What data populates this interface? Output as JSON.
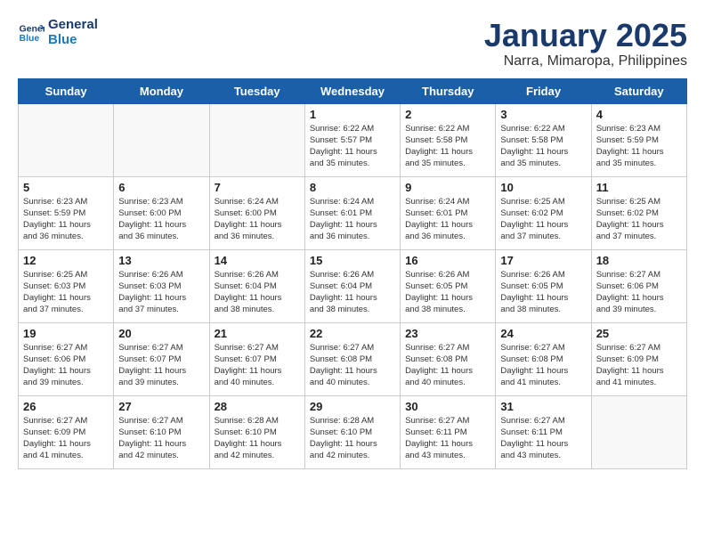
{
  "logo": {
    "line1": "General",
    "line2": "Blue"
  },
  "title": "January 2025",
  "subtitle": "Narra, Mimaropa, Philippines",
  "days": [
    "Sunday",
    "Monday",
    "Tuesday",
    "Wednesday",
    "Thursday",
    "Friday",
    "Saturday"
  ],
  "weeks": [
    [
      {
        "day": "",
        "info": ""
      },
      {
        "day": "",
        "info": ""
      },
      {
        "day": "",
        "info": ""
      },
      {
        "day": "1",
        "info": "Sunrise: 6:22 AM\nSunset: 5:57 PM\nDaylight: 11 hours\nand 35 minutes."
      },
      {
        "day": "2",
        "info": "Sunrise: 6:22 AM\nSunset: 5:58 PM\nDaylight: 11 hours\nand 35 minutes."
      },
      {
        "day": "3",
        "info": "Sunrise: 6:22 AM\nSunset: 5:58 PM\nDaylight: 11 hours\nand 35 minutes."
      },
      {
        "day": "4",
        "info": "Sunrise: 6:23 AM\nSunset: 5:59 PM\nDaylight: 11 hours\nand 35 minutes."
      }
    ],
    [
      {
        "day": "5",
        "info": "Sunrise: 6:23 AM\nSunset: 5:59 PM\nDaylight: 11 hours\nand 36 minutes."
      },
      {
        "day": "6",
        "info": "Sunrise: 6:23 AM\nSunset: 6:00 PM\nDaylight: 11 hours\nand 36 minutes."
      },
      {
        "day": "7",
        "info": "Sunrise: 6:24 AM\nSunset: 6:00 PM\nDaylight: 11 hours\nand 36 minutes."
      },
      {
        "day": "8",
        "info": "Sunrise: 6:24 AM\nSunset: 6:01 PM\nDaylight: 11 hours\nand 36 minutes."
      },
      {
        "day": "9",
        "info": "Sunrise: 6:24 AM\nSunset: 6:01 PM\nDaylight: 11 hours\nand 36 minutes."
      },
      {
        "day": "10",
        "info": "Sunrise: 6:25 AM\nSunset: 6:02 PM\nDaylight: 11 hours\nand 37 minutes."
      },
      {
        "day": "11",
        "info": "Sunrise: 6:25 AM\nSunset: 6:02 PM\nDaylight: 11 hours\nand 37 minutes."
      }
    ],
    [
      {
        "day": "12",
        "info": "Sunrise: 6:25 AM\nSunset: 6:03 PM\nDaylight: 11 hours\nand 37 minutes."
      },
      {
        "day": "13",
        "info": "Sunrise: 6:26 AM\nSunset: 6:03 PM\nDaylight: 11 hours\nand 37 minutes."
      },
      {
        "day": "14",
        "info": "Sunrise: 6:26 AM\nSunset: 6:04 PM\nDaylight: 11 hours\nand 38 minutes."
      },
      {
        "day": "15",
        "info": "Sunrise: 6:26 AM\nSunset: 6:04 PM\nDaylight: 11 hours\nand 38 minutes."
      },
      {
        "day": "16",
        "info": "Sunrise: 6:26 AM\nSunset: 6:05 PM\nDaylight: 11 hours\nand 38 minutes."
      },
      {
        "day": "17",
        "info": "Sunrise: 6:26 AM\nSunset: 6:05 PM\nDaylight: 11 hours\nand 38 minutes."
      },
      {
        "day": "18",
        "info": "Sunrise: 6:27 AM\nSunset: 6:06 PM\nDaylight: 11 hours\nand 39 minutes."
      }
    ],
    [
      {
        "day": "19",
        "info": "Sunrise: 6:27 AM\nSunset: 6:06 PM\nDaylight: 11 hours\nand 39 minutes."
      },
      {
        "day": "20",
        "info": "Sunrise: 6:27 AM\nSunset: 6:07 PM\nDaylight: 11 hours\nand 39 minutes."
      },
      {
        "day": "21",
        "info": "Sunrise: 6:27 AM\nSunset: 6:07 PM\nDaylight: 11 hours\nand 40 minutes."
      },
      {
        "day": "22",
        "info": "Sunrise: 6:27 AM\nSunset: 6:08 PM\nDaylight: 11 hours\nand 40 minutes."
      },
      {
        "day": "23",
        "info": "Sunrise: 6:27 AM\nSunset: 6:08 PM\nDaylight: 11 hours\nand 40 minutes."
      },
      {
        "day": "24",
        "info": "Sunrise: 6:27 AM\nSunset: 6:08 PM\nDaylight: 11 hours\nand 41 minutes."
      },
      {
        "day": "25",
        "info": "Sunrise: 6:27 AM\nSunset: 6:09 PM\nDaylight: 11 hours\nand 41 minutes."
      }
    ],
    [
      {
        "day": "26",
        "info": "Sunrise: 6:27 AM\nSunset: 6:09 PM\nDaylight: 11 hours\nand 41 minutes."
      },
      {
        "day": "27",
        "info": "Sunrise: 6:27 AM\nSunset: 6:10 PM\nDaylight: 11 hours\nand 42 minutes."
      },
      {
        "day": "28",
        "info": "Sunrise: 6:28 AM\nSunset: 6:10 PM\nDaylight: 11 hours\nand 42 minutes."
      },
      {
        "day": "29",
        "info": "Sunrise: 6:28 AM\nSunset: 6:10 PM\nDaylight: 11 hours\nand 42 minutes."
      },
      {
        "day": "30",
        "info": "Sunrise: 6:27 AM\nSunset: 6:11 PM\nDaylight: 11 hours\nand 43 minutes."
      },
      {
        "day": "31",
        "info": "Sunrise: 6:27 AM\nSunset: 6:11 PM\nDaylight: 11 hours\nand 43 minutes."
      },
      {
        "day": "",
        "info": ""
      }
    ]
  ]
}
